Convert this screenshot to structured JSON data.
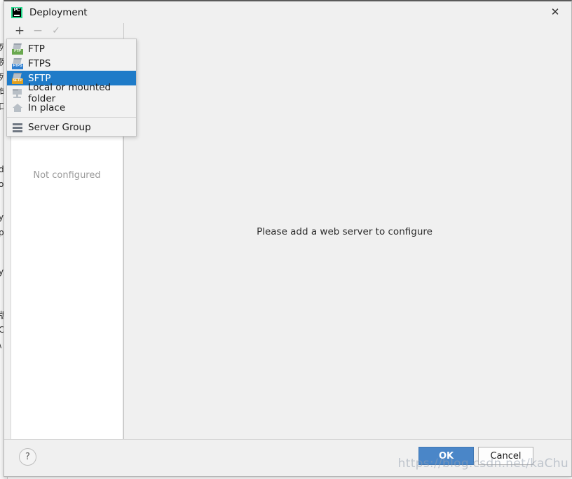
{
  "window": {
    "title": "Deployment",
    "app_icon": "pycharm-icon",
    "close_label": "✕"
  },
  "toolbar": {
    "add_label": "+",
    "remove_label": "−",
    "apply_label": "✓"
  },
  "left_panel": {
    "empty_text": "Not configured"
  },
  "right_panel": {
    "message": "Please add a web server to configure"
  },
  "popup_menu": {
    "items": [
      {
        "label": "FTP",
        "icon": "ftp-icon",
        "tag": "FTP",
        "selected": false
      },
      {
        "label": "FTPS",
        "icon": "ftps-icon",
        "tag": "FTPS",
        "selected": false
      },
      {
        "label": "SFTP",
        "icon": "sftp-icon",
        "tag": "SFTP",
        "selected": true
      },
      {
        "label": "Local or mounted folder",
        "icon": "local-folder-icon",
        "selected": false
      },
      {
        "label": "In place",
        "icon": "home-icon",
        "selected": false
      },
      {
        "label": "Server Group",
        "icon": "server-group-icon",
        "selected": false
      }
    ]
  },
  "footer": {
    "help_label": "?",
    "ok_label": "OK",
    "cancel_label": "Cancel"
  },
  "watermark": {
    "text": "https://blog.csdn.net/kaChu"
  },
  "background_editor": {
    "lines": [
      "列",
      "例",
      "列",
      "句",
      "口",
      "da",
      "on",
      "y",
      "p",
      "y",
      "版",
      "C",
      "\\"
    ]
  },
  "colors": {
    "accent": "#1f7bc8",
    "ok_button": "#4a86c8",
    "dialog_bg": "#f0f0f0",
    "panel_bg": "#ffffff",
    "ftp_tag": "#6aa84f",
    "ftps_tag": "#2f7fd0",
    "sftp_tag": "#e0a020"
  }
}
